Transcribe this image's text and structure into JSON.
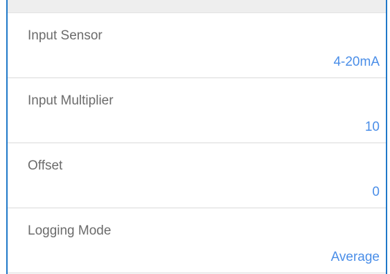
{
  "colors": {
    "frame_border": "#1f78c8",
    "label_text": "#6b6b6b",
    "value_text": "#4a8ee8",
    "divider": "#dadada",
    "top_strip": "#eeeeee"
  },
  "settings": {
    "items": [
      {
        "label": "Input Sensor",
        "value": "4-20mA"
      },
      {
        "label": "Input Multiplier",
        "value": "10"
      },
      {
        "label": "Offset",
        "value": "0"
      },
      {
        "label": "Logging Mode",
        "value": "Average"
      }
    ]
  }
}
